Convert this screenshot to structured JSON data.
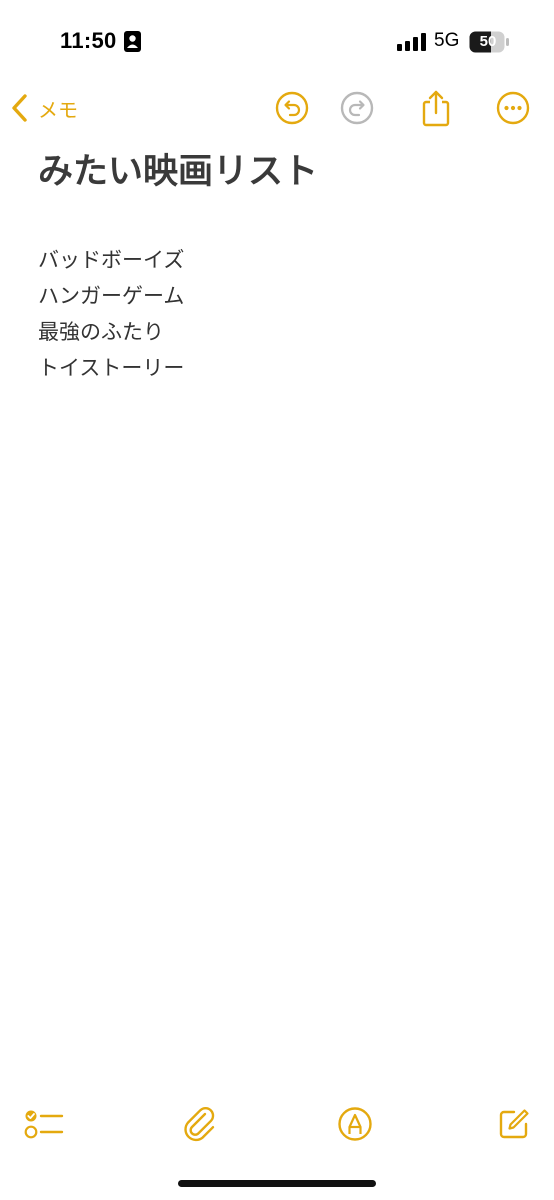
{
  "status_bar": {
    "time": "11:50",
    "network": "5G",
    "battery": "50",
    "icons": [
      "id-card-icon",
      "signal-bars-icon",
      "battery-icon"
    ]
  },
  "nav": {
    "back_label": "メモ",
    "icons": [
      "chevron-left-icon",
      "undo-icon",
      "redo-icon",
      "share-icon",
      "more-icon"
    ]
  },
  "note": {
    "title": "みたい映画リスト",
    "lines": [
      "バッドボーイズ",
      "ハンガーゲーム",
      "最強のふたり",
      "トイストーリー"
    ]
  },
  "toolbar": {
    "icons": [
      "checklist-icon",
      "paperclip-icon",
      "markup-pen-icon",
      "compose-icon"
    ]
  },
  "colors": {
    "accent": "#E4A90F",
    "disabled": "#B8B8B8",
    "text": "#333333",
    "background": "#FFFFFF"
  }
}
